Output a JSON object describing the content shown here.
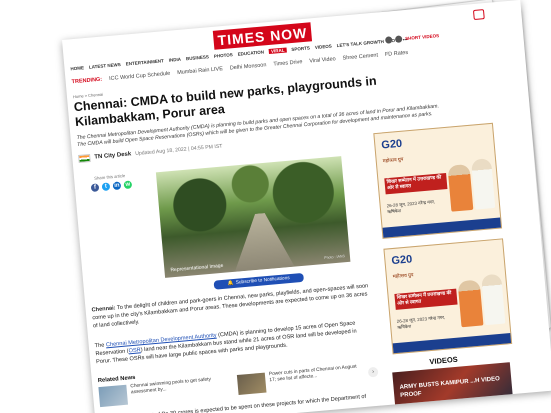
{
  "header": {
    "logo_text": "TIMES NOW",
    "nav": [
      "HOME",
      "LATEST NEWS",
      "ENTERTAINMENT",
      "INDIA",
      "BUSINESS",
      "PHOTOS",
      "EDUCATION",
      "VIRAL",
      "SPORTS",
      "VIDEOS",
      "LET'S TALK GROWTH",
      "LOT",
      "•••"
    ],
    "active_nav_index": 7,
    "short_videos": "SHORT VIDEOS"
  },
  "trending": {
    "label": "TRENDING:",
    "items": [
      "ICC World Cup Schedule",
      "Mumbai Rain LIVE",
      "Delhi Monsoon",
      "Times Drive",
      "Viral Video",
      "Shree Cement",
      "FD Rates"
    ]
  },
  "breadcrumb": "Home  >  Chennai",
  "article": {
    "title": "Chennai: CMDA to build new parks, playgrounds in Kilambakkam, Porur area",
    "summary": "The Chennai Metropolitan Development Authority (CMDA) is planning to build parks and open spaces on a total of 36 acres of land in Porur and Kilambakkam. The CMDA will build Open Space Reservations (OSRs) which will be given to the Greater Chennai Corporation for development and maintenance as parks.",
    "author": "TN City Desk",
    "updated": "Updated Aug 18, 2022 | 04:55 PM IST",
    "share_label": "Share this article",
    "image_caption": "Representational Image",
    "image_credit": "Photo : IANS",
    "subscribe_label": "Subscribe to Notifications",
    "p1_lead": "Chennai:",
    "p1_rest": " To the delight of children and park-goers in Chennai, new parks, playfields, and open-spaces will soon come up in the city's Kilambakkam and Porur areas. These developments are expected to come up on 36 acres of land collectively.",
    "p2_link1": "Chennai Metropolitan Development Authority",
    "p2_a": "The ",
    "p2_b": " (CMDA) is planning to develop 15 acres of Open Space Reservation (",
    "p2_link2": "OSR",
    "p2_c": ") land near the Kilambakkam bus stand while 21 acres of OSR land will be developed in Porur. These OSRs will have large public spaces with parks and playgrounds.",
    "related_heading": "Related News",
    "related": [
      {
        "title": "Chennai swimming pools to get safety assessment by..."
      },
      {
        "title": "Power cuts in parts of Chennai on August 17; see list of affecte..."
      }
    ],
    "p3": "An estimated amount of Rs 30 crores is expected to be spent on these projects for which the Department of Tourism and department of"
  },
  "ads": [
    {
      "brand": "G20",
      "hindi": "महोत्सव ग्रुप",
      "headline": "शिखर सम्मेलन में उत्तराखण्ड की ओर से स्वागत",
      "dates": "26-28 जून, 2023 नरेन्द्र नगर, ऋषिकेश"
    },
    {
      "brand": "G20",
      "hindi": "महोत्सव ग्रुप",
      "headline": "शिखर सम्मेलन में उत्तराखण्ड की ओर से स्वागत",
      "dates": "26-28 जून, 2023 नरेन्द्र नगर, ऋषिकेश"
    }
  ],
  "videos": {
    "heading": "VIDEOS",
    "title": "ARMY BUSTS KAMIPUR ...H VIDEO PROOF"
  },
  "colors": {
    "brand_red": "#d4061a",
    "link_blue": "#1f4fb5",
    "subscribe_blue": "#1f4fb5"
  }
}
